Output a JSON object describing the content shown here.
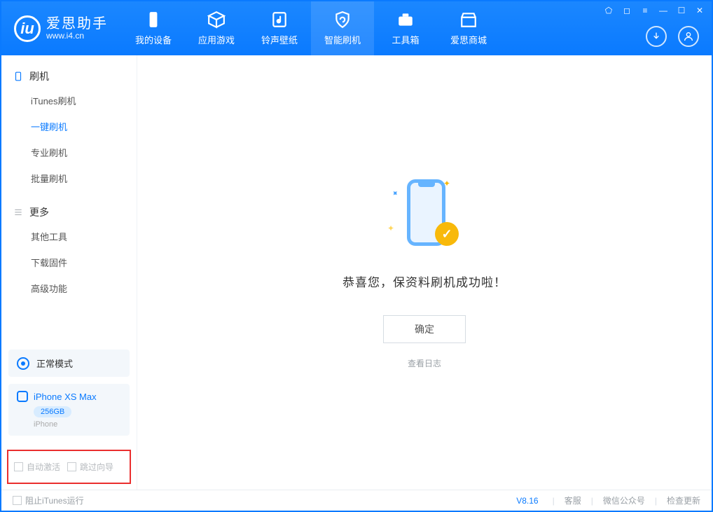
{
  "app": {
    "title": "爱思助手",
    "subtitle": "www.i4.cn"
  },
  "nav": [
    {
      "label": "我的设备"
    },
    {
      "label": "应用游戏"
    },
    {
      "label": "铃声壁纸"
    },
    {
      "label": "智能刷机"
    },
    {
      "label": "工具箱"
    },
    {
      "label": "爱思商城"
    }
  ],
  "sidebar": {
    "groups": [
      {
        "title": "刷机",
        "items": [
          {
            "label": "iTunes刷机"
          },
          {
            "label": "一键刷机",
            "active": true
          },
          {
            "label": "专业刷机"
          },
          {
            "label": "批量刷机"
          }
        ]
      },
      {
        "title": "更多",
        "items": [
          {
            "label": "其他工具"
          },
          {
            "label": "下载固件"
          },
          {
            "label": "高级功能"
          }
        ]
      }
    ],
    "mode": "正常模式",
    "device": {
      "name": "iPhone XS Max",
      "capacity": "256GB",
      "type": "iPhone"
    },
    "checks": {
      "auto_activate": "自动激活",
      "skip_guide": "跳过向导"
    }
  },
  "main": {
    "success_title": "恭喜您，保资料刷机成功啦！",
    "ok_label": "确定",
    "log_label": "查看日志"
  },
  "footer": {
    "block_itunes": "阻止iTunes运行",
    "version": "V8.16",
    "links": [
      "客服",
      "微信公众号",
      "检查更新"
    ]
  }
}
